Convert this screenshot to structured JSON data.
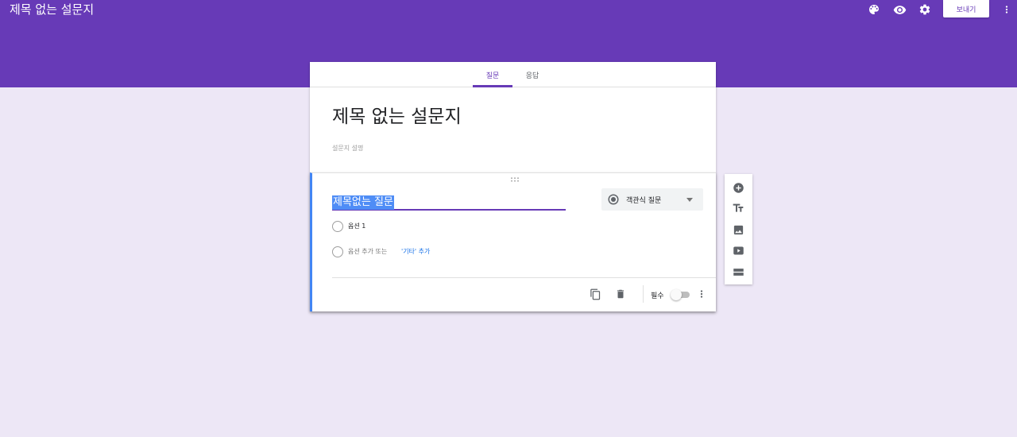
{
  "header": {
    "doc_title": "제목 없는 설문지",
    "send_label": "보내기",
    "icons": [
      "palette-icon",
      "preview-eye-icon",
      "settings-gear-icon",
      "more-vert-icon"
    ]
  },
  "tabs": [
    {
      "label": "질문",
      "active": true
    },
    {
      "label": "응답",
      "active": false
    }
  ],
  "form": {
    "title": "제목 없는 설문지",
    "description_placeholder": "설문지 설명"
  },
  "question": {
    "title": "제목없는 질문",
    "type_label": "객관식 질문",
    "options": [
      "옵션 1"
    ],
    "add_option_label": "옵션 추가 또는",
    "add_other_label": "'기타' 추가",
    "required_label": "필수",
    "required": false
  },
  "side_toolbar": {
    "items": [
      "add-question-icon",
      "add-title-icon",
      "add-image-icon",
      "add-video-icon",
      "add-section-icon"
    ]
  },
  "colors": {
    "brand": "#673ab7",
    "background": "#ede7f6",
    "focus": "#4285f4",
    "link": "#1a73e8"
  }
}
